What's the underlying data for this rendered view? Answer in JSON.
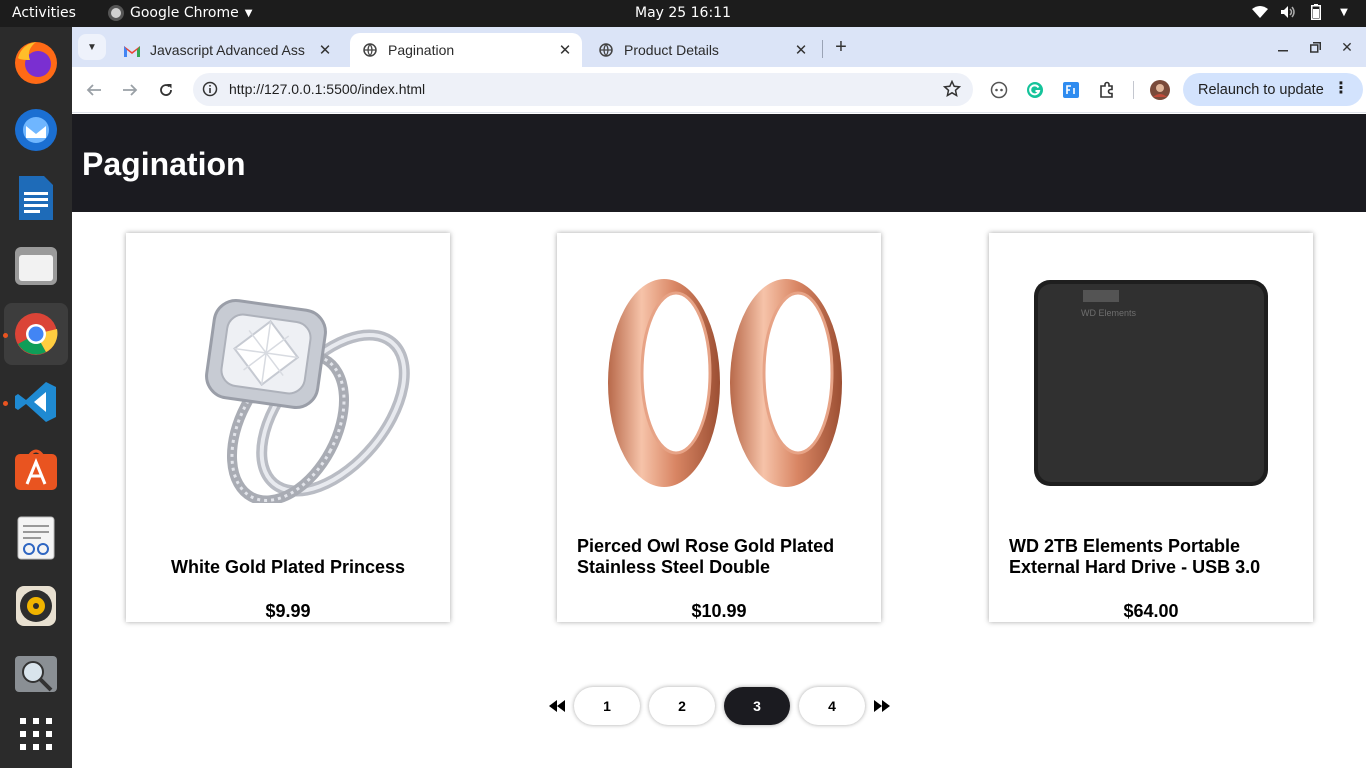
{
  "os": {
    "activities": "Activities",
    "app_menu": "Google Chrome",
    "clock": "May 25  16:11",
    "dock": [
      "firefox-icon",
      "thunderbird-icon",
      "writer-icon",
      "files-icon",
      "chrome-icon",
      "vscode-icon",
      "app-center-icon",
      "text-editor-icon",
      "rhythmbox-icon",
      "image-viewer-icon",
      "show-apps-icon"
    ]
  },
  "browser": {
    "tabs": [
      {
        "title": "Javascript Advanced Ass",
        "icon": "gmail-icon"
      },
      {
        "title": "Pagination",
        "icon": "globe-icon"
      },
      {
        "title": "Product Details",
        "icon": "globe-icon"
      }
    ],
    "url": "http://127.0.0.1:5500/index.html",
    "relaunch": "Relaunch to update"
  },
  "page": {
    "title": "Pagination",
    "products": [
      {
        "name": "White Gold Plated Princess",
        "price": "$9.99"
      },
      {
        "name": "Pierced Owl Rose Gold Plated Stainless Steel Double",
        "price": "$10.99"
      },
      {
        "name": "WD 2TB Elements Portable External Hard Drive - USB 3.0",
        "price": "$64.00"
      }
    ],
    "pagination": {
      "pages": [
        "1",
        "2",
        "3",
        "4"
      ],
      "current": "3"
    },
    "drive_label": "WD Elements"
  }
}
